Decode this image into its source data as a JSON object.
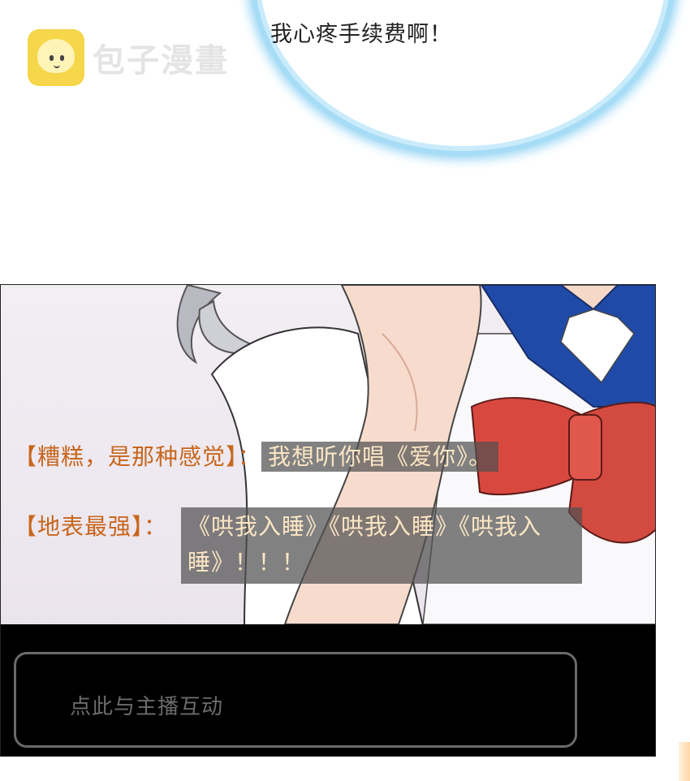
{
  "watermark": {
    "text": "包子漫畫"
  },
  "bubble": {
    "text": "我心疼手续费啊！"
  },
  "chat": [
    {
      "name": "【糟糕，是那种感觉】：",
      "message": "我想听你唱《爱你》。"
    },
    {
      "name": "【地表最强】：",
      "message": "《哄我入睡》《哄我入睡》《哄我入睡》！！！"
    }
  ],
  "input": {
    "placeholder": "点此与主播互动"
  },
  "colors": {
    "username": "#c8661c",
    "bubble_glow": "#8fd2f3",
    "bow": "#d9483f",
    "collar": "#1f4aa8"
  }
}
